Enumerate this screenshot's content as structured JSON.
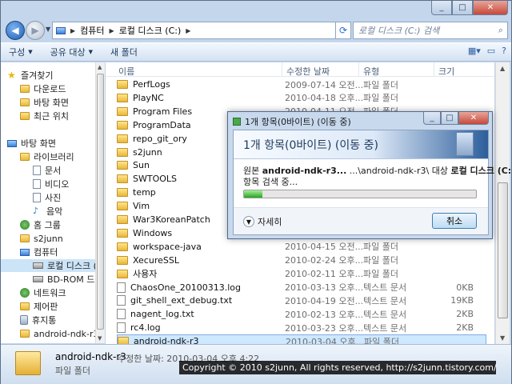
{
  "address": {
    "crumbs": [
      "컴퓨터",
      "로컬 디스크 (C:)"
    ],
    "search_placeholder": "로컬 디스크 (C:) 검색"
  },
  "toolbar": {
    "organize": "구성",
    "share": "공유 대상",
    "new_folder": "새 폴더"
  },
  "nav": {
    "items": [
      {
        "label": "즐겨찾기",
        "icon": "star-icon"
      },
      {
        "label": "다운로드",
        "icon": "folder-icon"
      },
      {
        "label": "바탕 화면",
        "icon": "folder-icon"
      },
      {
        "label": "최근 위치",
        "icon": "folder-icon"
      },
      {
        "label": "바탕 화면",
        "icon": "desktop-icon"
      },
      {
        "label": "라이브러리",
        "icon": "folder-icon"
      },
      {
        "label": "문서",
        "icon": "document-icon"
      },
      {
        "label": "비디오",
        "icon": "document-icon"
      },
      {
        "label": "사진",
        "icon": "document-icon"
      },
      {
        "label": "음악",
        "icon": "music-icon"
      },
      {
        "label": "홈 그룹",
        "icon": "network-icon"
      },
      {
        "label": "s2junn",
        "icon": "folder-icon"
      },
      {
        "label": "컴퓨터",
        "icon": "computer-icon"
      },
      {
        "label": "로컬 디스크 (C",
        "icon": "drive-icon"
      },
      {
        "label": "BD-ROM 드라",
        "icon": "drive-icon"
      },
      {
        "label": "네트워크",
        "icon": "network-icon"
      },
      {
        "label": "제어판",
        "icon": "folder-icon"
      },
      {
        "label": "휴지통",
        "icon": "trash-icon"
      },
      {
        "label": "android-ndk-r3-",
        "icon": "folder-icon"
      },
      {
        "label": "android-ndk-r3-",
        "icon": "folder-icon"
      }
    ]
  },
  "columns": {
    "name": "이름",
    "date": "수정한 날짜",
    "type": "유형",
    "size": "크기"
  },
  "files": [
    {
      "name": "PerfLogs",
      "date": "2009-07-14 오전...",
      "type": "파일 폴더",
      "size": "",
      "kind": "folder"
    },
    {
      "name": "PlayNC",
      "date": "2010-04-18 오후...",
      "type": "파일 폴더",
      "size": "",
      "kind": "folder"
    },
    {
      "name": "Program Files",
      "date": "2010-04-11 오전...",
      "type": "파일 폴더",
      "size": "",
      "kind": "folder"
    },
    {
      "name": "ProgramData",
      "date": "",
      "type": "",
      "size": "",
      "kind": "folder"
    },
    {
      "name": "repo_git_ory",
      "date": "",
      "type": "",
      "size": "",
      "kind": "folder"
    },
    {
      "name": "s2junn",
      "date": "",
      "type": "",
      "size": "",
      "kind": "folder"
    },
    {
      "name": "Sun",
      "date": "",
      "type": "",
      "size": "",
      "kind": "folder"
    },
    {
      "name": "SWTOOLS",
      "date": "",
      "type": "",
      "size": "",
      "kind": "folder"
    },
    {
      "name": "temp",
      "date": "",
      "type": "",
      "size": "",
      "kind": "folder"
    },
    {
      "name": "Vim",
      "date": "",
      "type": "",
      "size": "",
      "kind": "folder"
    },
    {
      "name": "War3KoreanPatch",
      "date": "",
      "type": "",
      "size": "",
      "kind": "folder"
    },
    {
      "name": "Windows",
      "date": "",
      "type": "",
      "size": "",
      "kind": "folder"
    },
    {
      "name": "workspace-java",
      "date": "2010-04-15 오전...",
      "type": "파일 폴더",
      "size": "",
      "kind": "folder"
    },
    {
      "name": "XecureSSL",
      "date": "2010-02-24 오후...",
      "type": "파일 폴더",
      "size": "",
      "kind": "folder"
    },
    {
      "name": "사용자",
      "date": "2010-02-11 오후...",
      "type": "파일 폴더",
      "size": "",
      "kind": "folder"
    },
    {
      "name": "ChaosOne_20100313.log",
      "date": "2010-03-13 오후...",
      "type": "텍스트 문서",
      "size": "0KB",
      "kind": "text"
    },
    {
      "name": "git_shell_ext_debug.txt",
      "date": "2010-04-19 오전...",
      "type": "텍스트 문서",
      "size": "19KB",
      "kind": "text"
    },
    {
      "name": "nagent_log.txt",
      "date": "2010-02-13 오후...",
      "type": "텍스트 문서",
      "size": "2KB",
      "kind": "text"
    },
    {
      "name": "rc4.log",
      "date": "2010-03-23 오후...",
      "type": "텍스트 문서",
      "size": "2KB",
      "kind": "text"
    },
    {
      "name": "android-ndk-r3",
      "date": "2010-03-04 오후...",
      "type": "파일 폴더",
      "size": "",
      "kind": "folder"
    }
  ],
  "details": {
    "name": "android-ndk-r3",
    "modified": "수정한 날짜: 2010-03-04 오후 4:22",
    "type": "파일 폴더"
  },
  "copyright": "Copyright © 2010 s2junn, All rights reserved, http://s2junn.tistory.com/",
  "dialog": {
    "title": "1개 항목(0바이트) (이동 중)",
    "heading": "1개 항목(0바이트) (이동 중)",
    "line1_prefix": "원본",
    "line1_src": "android-ndk-r3...",
    "line1_mid": "...\\android-ndk-r3\\ 대상",
    "line1_dst": "로컬 디스크 (C:)",
    "line2": "항목 검색 중...",
    "progress": 0.08,
    "more_label": "자세히",
    "cancel_label": "취소"
  }
}
